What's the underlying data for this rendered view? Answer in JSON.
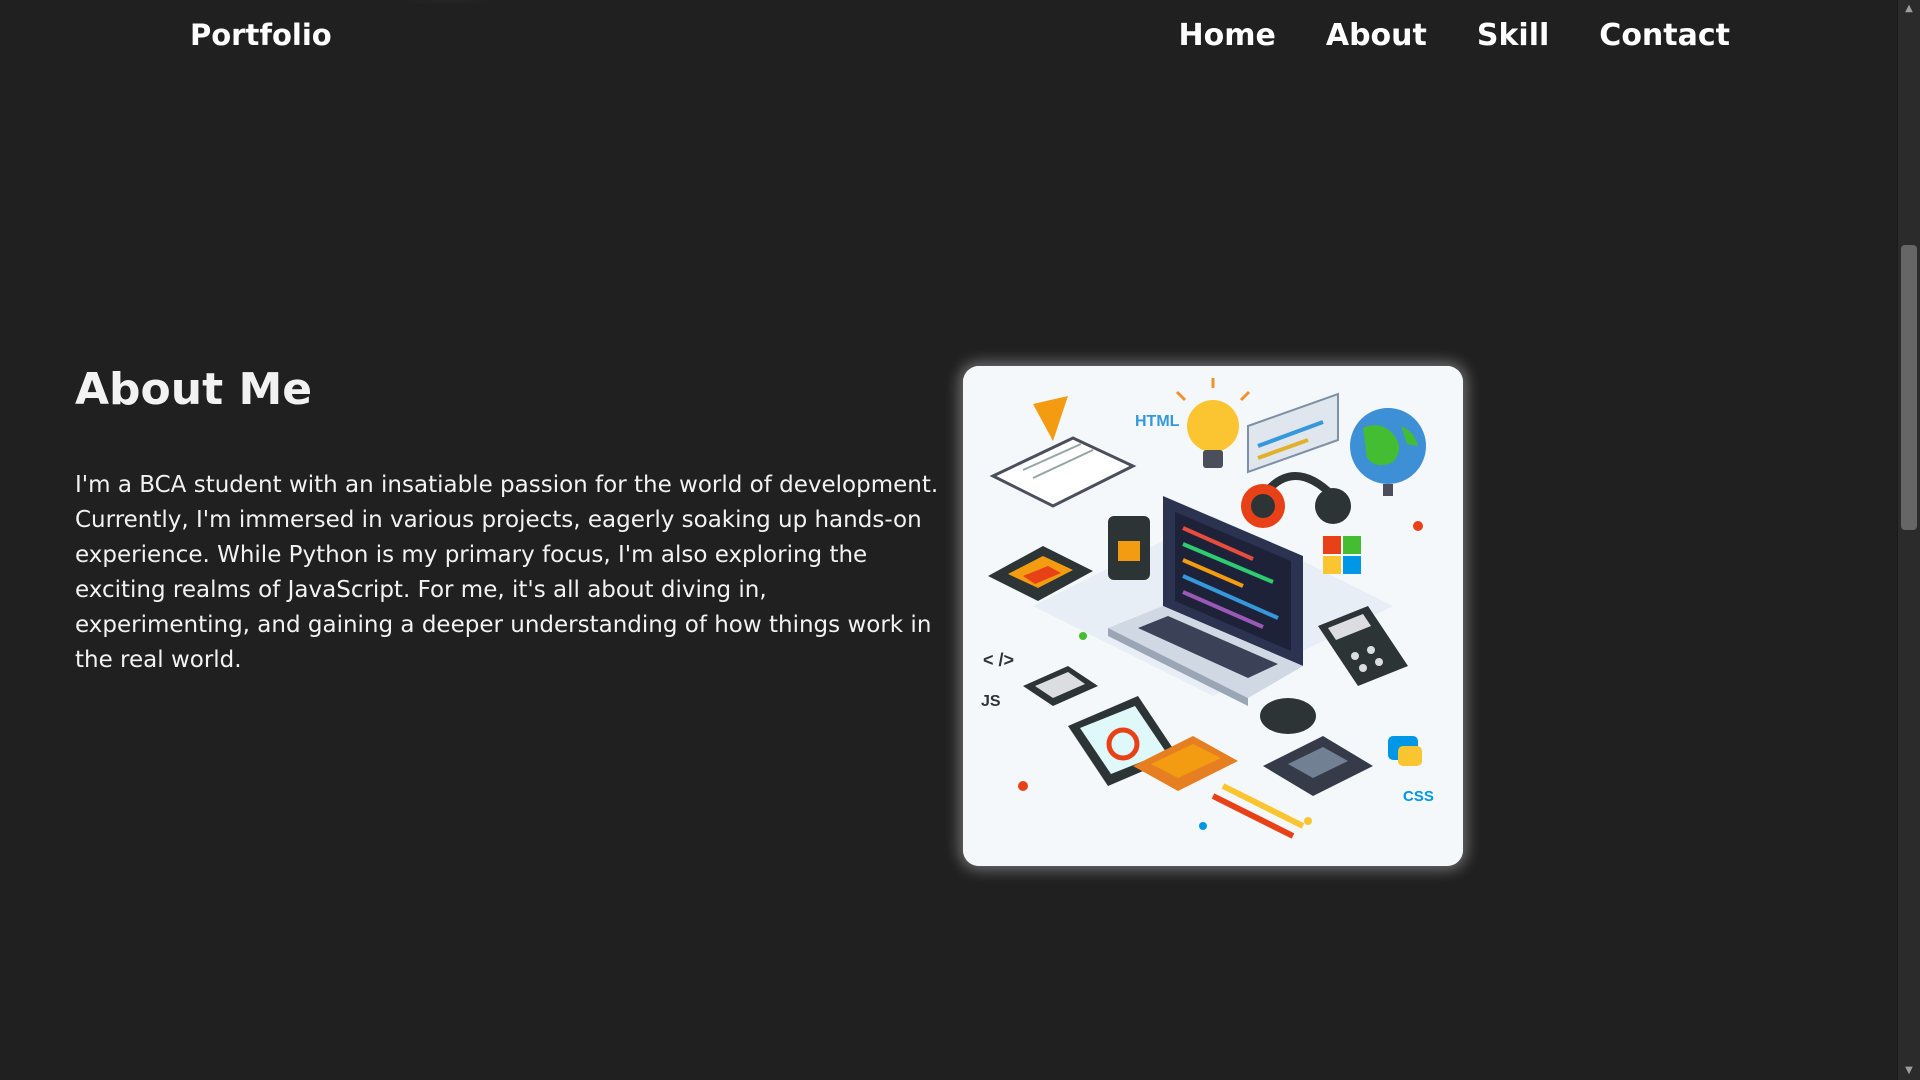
{
  "navbar": {
    "brand": "Portfolio",
    "links": [
      {
        "label": "Home"
      },
      {
        "label": "About"
      },
      {
        "label": "Skill"
      },
      {
        "label": "Contact"
      }
    ]
  },
  "about": {
    "title": "About Me",
    "text": "I'm a BCA student with an insatiable passion for the world of development. Currently, I'm immersed in various projects, eagerly soaking up hands-on experience. While Python is my primary focus, I'm also exploring the exciting realms of JavaScript. For me, it's all about diving in, experimenting, and gaining a deeper understanding of how things work in the real world."
  },
  "image": {
    "icon": "developer-workspace-illustration",
    "tags": [
      "HTML",
      "< />",
      "JS",
      "CSS"
    ]
  },
  "colors": {
    "background": "#202020",
    "text": "#f2f2f2",
    "card": "#f4f8fb"
  },
  "scrollbar": {
    "up_icon": "▲",
    "down_icon": "▼",
    "position_fraction": 0.35
  }
}
